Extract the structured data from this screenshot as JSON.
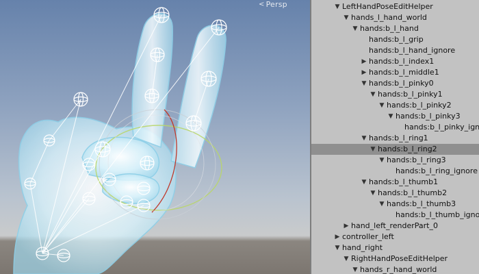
{
  "scene": {
    "persp_label": "Persp",
    "persp_icon": "perspective-arrow-icon"
  },
  "hierarchy": {
    "items": [
      {
        "label": "LeftHandPoseEditHelper",
        "expand": "expanded",
        "selected": false
      },
      {
        "label": "hands_l_hand_world",
        "expand": "expanded",
        "selected": false
      },
      {
        "label": "hands:b_l_hand",
        "expand": "expanded",
        "selected": false
      },
      {
        "label": "hands:b_l_grip",
        "expand": "none",
        "selected": false
      },
      {
        "label": "hands:b_l_hand_ignore",
        "expand": "none",
        "selected": false
      },
      {
        "label": "hands:b_l_index1",
        "expand": "collapsed",
        "selected": false
      },
      {
        "label": "hands:b_l_middle1",
        "expand": "collapsed",
        "selected": false
      },
      {
        "label": "hands:b_l_pinky0",
        "expand": "expanded",
        "selected": false
      },
      {
        "label": "hands:b_l_pinky1",
        "expand": "expanded",
        "selected": false
      },
      {
        "label": "hands:b_l_pinky2",
        "expand": "expanded",
        "selected": false
      },
      {
        "label": "hands:b_l_pinky3",
        "expand": "expanded",
        "selected": false
      },
      {
        "label": "hands:b_l_pinky_ignore",
        "expand": "none",
        "selected": false
      },
      {
        "label": "hands:b_l_ring1",
        "expand": "expanded",
        "selected": false
      },
      {
        "label": "hands:b_l_ring2",
        "expand": "expanded",
        "selected": true
      },
      {
        "label": "hands:b_l_ring3",
        "expand": "expanded",
        "selected": false
      },
      {
        "label": "hands:b_l_ring_ignore",
        "expand": "none",
        "selected": false
      },
      {
        "label": "hands:b_l_thumb1",
        "expand": "expanded",
        "selected": false
      },
      {
        "label": "hands:b_l_thumb2",
        "expand": "expanded",
        "selected": false
      },
      {
        "label": "hands:b_l_thumb3",
        "expand": "expanded",
        "selected": false
      },
      {
        "label": "hands:b_l_thumb_ignore",
        "expand": "none",
        "selected": false
      },
      {
        "label": "hand_left_renderPart_0",
        "expand": "collapsed",
        "selected": false
      },
      {
        "label": "controller_left",
        "expand": "collapsed",
        "selected": false
      },
      {
        "label": "hand_right",
        "expand": "expanded",
        "selected": false
      },
      {
        "label": "RightHandPoseEditHelper",
        "expand": "expanded",
        "selected": false
      },
      {
        "label": "hands_r_hand_world",
        "expand": "expanded",
        "selected": false
      }
    ]
  }
}
